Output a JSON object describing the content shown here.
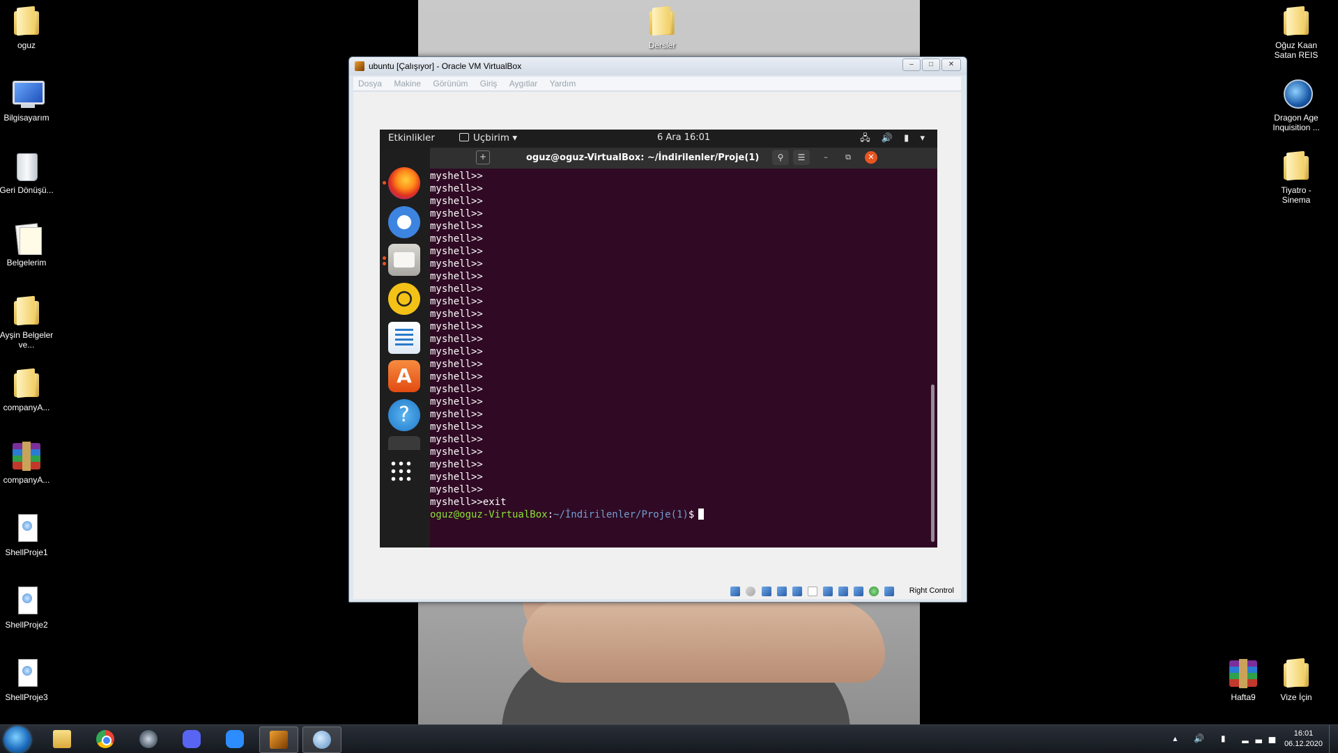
{
  "desktop": {
    "left_icons": [
      {
        "label": "oguz",
        "type": "folder"
      },
      {
        "label": "Bilgisayarım",
        "type": "computer"
      },
      {
        "label": "Geri Dönüşü...",
        "type": "recycle"
      },
      {
        "label": "Belgelerim",
        "type": "docs"
      },
      {
        "label": "Ayşin Belgeler ve...",
        "type": "folder"
      },
      {
        "label": "companyA...",
        "type": "folder"
      },
      {
        "label": "companyA...",
        "type": "winrar"
      },
      {
        "label": "ShellProje1",
        "type": "file"
      },
      {
        "label": "ShellProje2",
        "type": "file"
      },
      {
        "label": "ShellProje3",
        "type": "file"
      }
    ],
    "top_center_icon": {
      "label": "Dersler",
      "type": "folder"
    },
    "right_icons": [
      {
        "label": "Oğuz Kaan Satan REIS",
        "type": "folder"
      },
      {
        "label": "Dragon Age Inquisition ...",
        "type": "game"
      },
      {
        "label": "Tiyatro - Sinema",
        "type": "folder"
      }
    ],
    "bottom_right_icons": [
      {
        "label": "Hafta9",
        "type": "winrar"
      },
      {
        "label": "Vize İçin",
        "type": "folder"
      }
    ]
  },
  "vbox": {
    "title": "ubuntu [Çalışıyor] - Oracle VM VirtualBox",
    "menu": [
      "Dosya",
      "Makine",
      "Görünüm",
      "Giriş",
      "Aygıtlar",
      "Yardım"
    ],
    "status_label": "Right Control"
  },
  "ubuntu": {
    "activities": "Etkinlikler",
    "app_menu": "Uçbirim",
    "clock": "6 Ara  16:01",
    "tray": "🖧 🔊 ▮ ▾",
    "dock": [
      "firefox-icon",
      "thunderbird-icon",
      "files-icon",
      "rhythmbox-icon",
      "libreoffice-writer-icon",
      "software-store-icon",
      "help-icon",
      "terminal-icon"
    ]
  },
  "terminal": {
    "title": "oguz@oguz-VirtualBox: ~/İndirilenler/Proje(1)",
    "lines": [
      "myshell>>",
      "myshell>>",
      "myshell>>",
      "myshell>>",
      "myshell>>",
      "myshell>>",
      "myshell>>",
      "myshell>>",
      "myshell>>",
      "myshell>>",
      "myshell>>",
      "myshell>>",
      "myshell>>",
      "myshell>>",
      "myshell>>",
      "myshell>>",
      "myshell>>",
      "myshell>>",
      "myshell>>",
      "myshell>>",
      "myshell>>",
      "myshell>>",
      "myshell>>",
      "myshell>>",
      "myshell>>",
      "myshell>>",
      "myshell>>exit"
    ],
    "prompt_user": "oguz@oguz-VirtualBox",
    "prompt_sep": ":",
    "prompt_path": "~/İndirilenler/Proje(1)",
    "prompt_symbol": "$"
  },
  "taskbar": {
    "apps": [
      "explorer",
      "chrome",
      "steam",
      "discord",
      "zoom",
      "virtualbox",
      "game"
    ],
    "time": "16:01",
    "date": "06.12.2020"
  }
}
